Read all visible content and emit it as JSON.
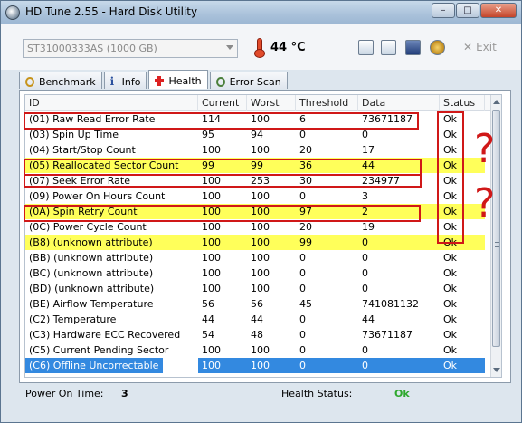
{
  "window": {
    "title": "HD Tune 2.55 - Hard Disk Utility",
    "buttons": {
      "minimize": "–",
      "maximize": "□",
      "close": "✕"
    }
  },
  "toolbar": {
    "drive": "ST31000333AS (1000 GB)",
    "temperature": "44 °C",
    "exit_label": "Exit",
    "exit_glyph": "✕"
  },
  "tabs": [
    {
      "label": "Benchmark",
      "icon": "benchmark-icon"
    },
    {
      "label": "Info",
      "icon": "info-icon"
    },
    {
      "label": "Health",
      "icon": "health-cross-icon",
      "active": true
    },
    {
      "label": "Error Scan",
      "icon": "error-scan-icon"
    }
  ],
  "table": {
    "columns": [
      "ID",
      "Current",
      "Worst",
      "Threshold",
      "Data",
      "Status"
    ],
    "rows": [
      {
        "id": "(01) Raw Read Error Rate",
        "current": "114",
        "worst": "100",
        "threshold": "6",
        "data": "73671187",
        "status": "Ok",
        "highlight": false
      },
      {
        "id": "(03) Spin Up Time",
        "current": "95",
        "worst": "94",
        "threshold": "0",
        "data": "0",
        "status": "Ok",
        "highlight": false
      },
      {
        "id": "(04) Start/Stop Count",
        "current": "100",
        "worst": "100",
        "threshold": "20",
        "data": "17",
        "status": "Ok",
        "highlight": false
      },
      {
        "id": "(05) Reallocated Sector Count",
        "current": "99",
        "worst": "99",
        "threshold": "36",
        "data": "44",
        "status": "Ok",
        "highlight": true
      },
      {
        "id": "(07) Seek Error Rate",
        "current": "100",
        "worst": "253",
        "threshold": "30",
        "data": "234977",
        "status": "Ok",
        "highlight": false
      },
      {
        "id": "(09) Power On Hours Count",
        "current": "100",
        "worst": "100",
        "threshold": "0",
        "data": "3",
        "status": "Ok",
        "highlight": false
      },
      {
        "id": "(0A) Spin Retry Count",
        "current": "100",
        "worst": "100",
        "threshold": "97",
        "data": "2",
        "status": "Ok",
        "highlight": true
      },
      {
        "id": "(0C) Power Cycle Count",
        "current": "100",
        "worst": "100",
        "threshold": "20",
        "data": "19",
        "status": "Ok",
        "highlight": false
      },
      {
        "id": "(B8) (unknown attribute)",
        "current": "100",
        "worst": "100",
        "threshold": "99",
        "data": "0",
        "status": "Ok",
        "highlight": true
      },
      {
        "id": "(BB) (unknown attribute)",
        "current": "100",
        "worst": "100",
        "threshold": "0",
        "data": "0",
        "status": "Ok",
        "highlight": false
      },
      {
        "id": "(BC) (unknown attribute)",
        "current": "100",
        "worst": "100",
        "threshold": "0",
        "data": "0",
        "status": "Ok",
        "highlight": false
      },
      {
        "id": "(BD) (unknown attribute)",
        "current": "100",
        "worst": "100",
        "threshold": "0",
        "data": "0",
        "status": "Ok",
        "highlight": false
      },
      {
        "id": "(BE) Airflow Temperature",
        "current": "56",
        "worst": "56",
        "threshold": "45",
        "data": "741081132",
        "status": "Ok",
        "highlight": false
      },
      {
        "id": "(C2) Temperature",
        "current": "44",
        "worst": "44",
        "threshold": "0",
        "data": "44",
        "status": "Ok",
        "highlight": false
      },
      {
        "id": "(C3) Hardware ECC Recovered",
        "current": "54",
        "worst": "48",
        "threshold": "0",
        "data": "73671187",
        "status": "Ok",
        "highlight": false
      },
      {
        "id": "(C5) Current Pending Sector",
        "current": "100",
        "worst": "100",
        "threshold": "0",
        "data": "0",
        "status": "Ok",
        "highlight": false
      },
      {
        "id": "(C6) Offline Uncorrectable",
        "current": "100",
        "worst": "100",
        "threshold": "0",
        "data": "0",
        "status": "Ok",
        "highlight": false,
        "selected": true
      }
    ]
  },
  "footer": {
    "power_on_label": "Power On Time:",
    "power_on_value": "3",
    "health_label": "Health Status:",
    "health_value": "Ok"
  },
  "annotations": {
    "marks": [
      "?",
      "?"
    ],
    "color": "#d01818"
  },
  "colors": {
    "highlight": "#ffff5a",
    "selected": "#3389e0",
    "ok_green": "#2ea82e"
  }
}
